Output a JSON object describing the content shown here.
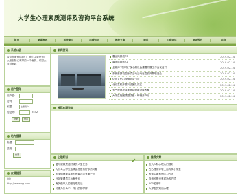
{
  "site": {
    "title": "大学生心理素质测评及咨询平台系统"
  },
  "nav": [
    "首页",
    "新闻资讯",
    "系统简介",
    "心理知识",
    "推荐文章",
    "测试",
    "心理测试",
    "测评预约",
    "后台"
  ],
  "notice": {
    "title": "系统公告",
    "text": "欢迎大家登陆我们，我们主要是为广大朋友随心有好的一个面的，希望大家越来越"
  },
  "login": {
    "title": "用户登陆",
    "username_label": "用户名:",
    "password_label": "密码:",
    "role_label": "权限:",
    "role_value": "注册用户",
    "code_label": "验证码:",
    "code_value": "2542",
    "login_btn": "登录",
    "reset_btn": "重置"
  },
  "search": {
    "title": "站内搜索",
    "title_label": "标题:",
    "type_label": "类别:",
    "search_btn": "搜索"
  },
  "links": {
    "title": "友情链接",
    "lines": [
      "QQ",
      "http://www.qq.com"
    ]
  },
  "news": {
    "title": "新闻资讯",
    "items": [
      {
        "text": "春运风景线73",
        "date": "2019-02-14"
      },
      {
        "text": "春运风景线72",
        "date": "2019-02-14"
      },
      {
        "text": "全媒体“不掉队”及小康社会建置开展工作会议召开",
        "date": "2019-02-14"
      },
      {
        "text": "东莞首部校园专项活动活动在高校开展联谊会",
        "date": "2019-02-14"
      },
      {
        "text": "切勿文化心理解析中“血”",
        "date": "2019-02-14"
      },
      {
        "text": "北京高校开展科技团队花实",
        "date": "2019-02-14"
      },
      {
        "text": "天气速度冷成家庭动物要进屋大家",
        "date": "2019-02-14"
      },
      {
        "text": "大学生社团课题讲座：邮储开户行",
        "date": "2019-02-14"
      }
    ]
  },
  "recommend": {
    "title": "推荐心理咨询"
  },
  "knowledge": {
    "title": "心理知识",
    "items": [
      "爱与健康是这时候的人生任务",
      "为什么大学生活情绪总是有好多的问题",
      "相关情绪被重视的首要办法有哪一些",
      "社区管理员平台有专业",
      "有关做事儿的难处理办法",
      "好像为什么不一样儿的那样样"
    ]
  },
  "articles": {
    "title": "推荐文章",
    "items": [
      "五大人际心理入门规划",
      "在心理测评学上面有关小学生",
      "大学生要有的学习方法",
      "自信也是没有成功的方式",
      "200名老年",
      "大学生的知识心理"
    ]
  }
}
